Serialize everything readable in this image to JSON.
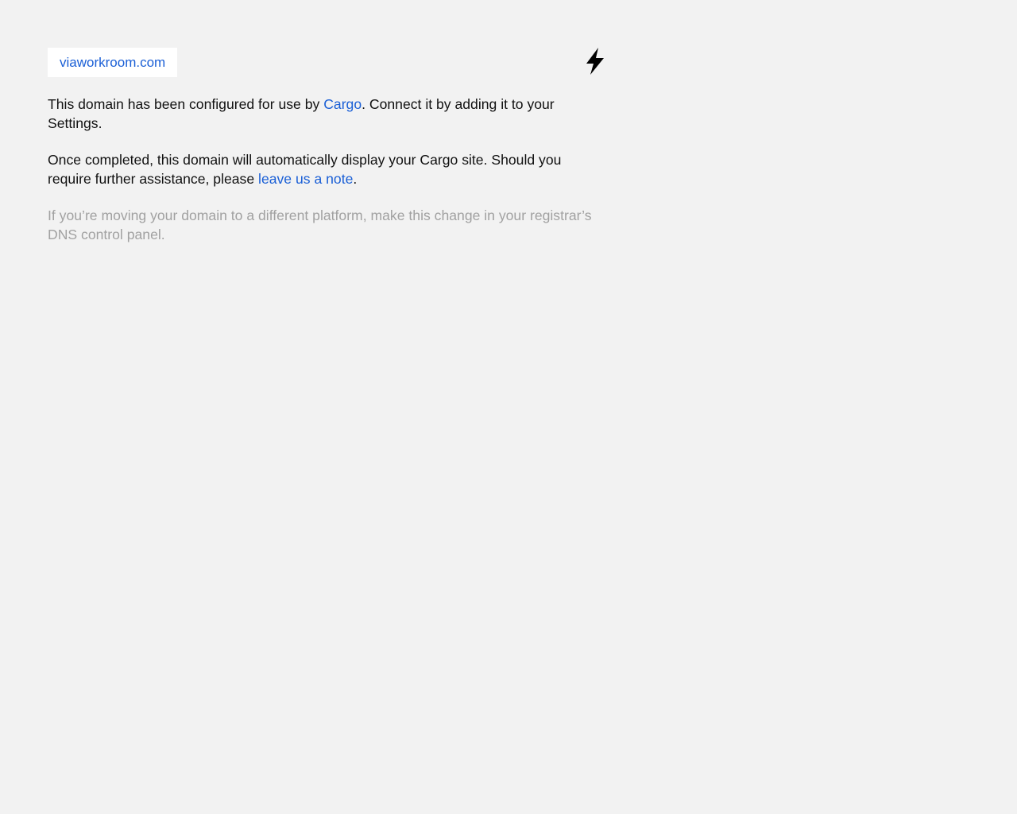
{
  "domain": {
    "name": "viaworkroom.com"
  },
  "logo": {
    "icon": "lightning-bolt-icon"
  },
  "message": {
    "p1_before": "This domain has been configured for use by ",
    "p1_link": "Cargo",
    "p1_after": ". Connect it by adding it to your Settings.",
    "p2_before": "Once completed, this domain will automatically display your Cargo site. Should you require further assistance, please ",
    "p2_link": "leave us a note",
    "p2_after": ".",
    "p3": "If you’re moving your domain to a different platform, make this change in your registrar’s DNS control panel."
  },
  "colors": {
    "background": "#f2f2f2",
    "link": "#1a5fd6",
    "text": "#111111",
    "muted": "#a1a1a1"
  }
}
